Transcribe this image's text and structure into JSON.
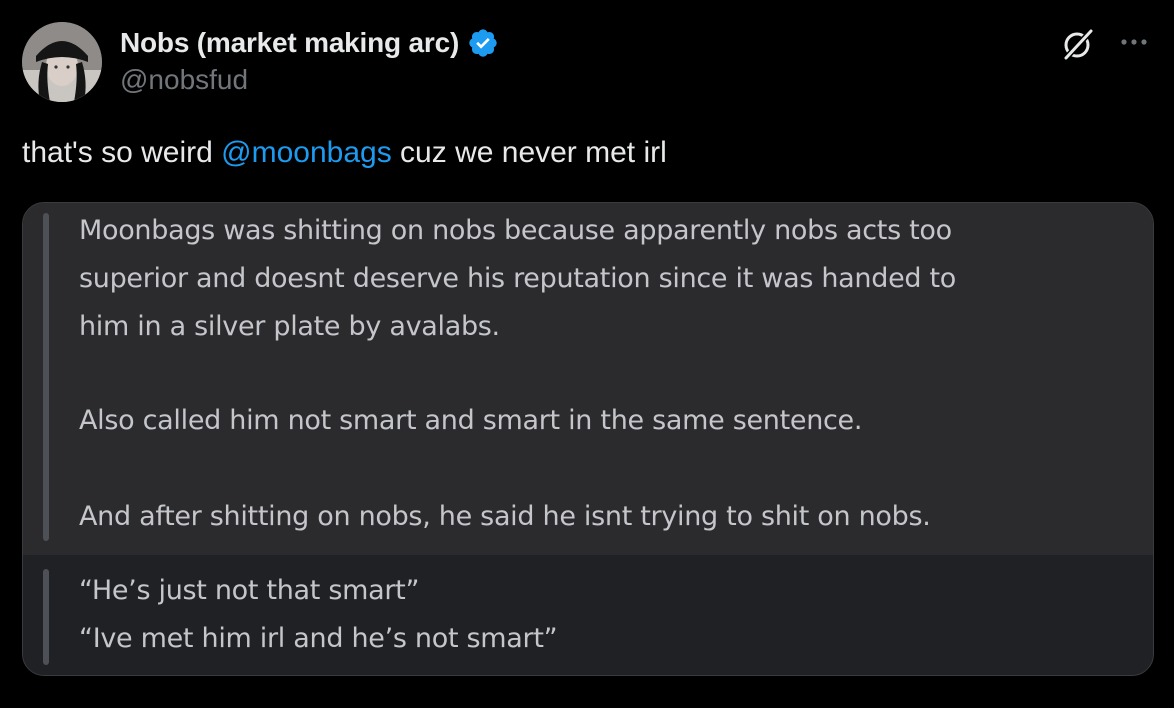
{
  "author": {
    "display_name": "Nobs (market making arc)",
    "handle": "@nobsfud",
    "verified": true,
    "avatar_icon": "user-avatar"
  },
  "tweet": {
    "text_before": "that's so weird ",
    "mention": "@moonbags",
    "text_after": " cuz we never met irl"
  },
  "screenshot": {
    "upper_lines": [
      "Moonbags was shitting on nobs because apparently nobs acts too",
      "superior and doesnt deserve his reputation since it was handed to",
      "him in a silver plate by avalabs.",
      "Also called him not smart and smart in the same sentence.",
      "And after shitting on nobs, he said he isnt trying to shit on nobs."
    ],
    "lower_lines": [
      "“He’s just not that smart”",
      "“Ive met him irl and he’s not smart”"
    ]
  },
  "icons": {
    "verified": "verified-badge-icon",
    "grok": "grok-icon",
    "more": "more-icon"
  },
  "colors": {
    "background": "#000000",
    "text": "#e7e9ea",
    "secondary_text": "#71767b",
    "mention": "#1d9bf0",
    "verified": "#1d9bf0",
    "quote_upper_bg": "#2b2b2e",
    "quote_lower_bg": "#202124"
  }
}
